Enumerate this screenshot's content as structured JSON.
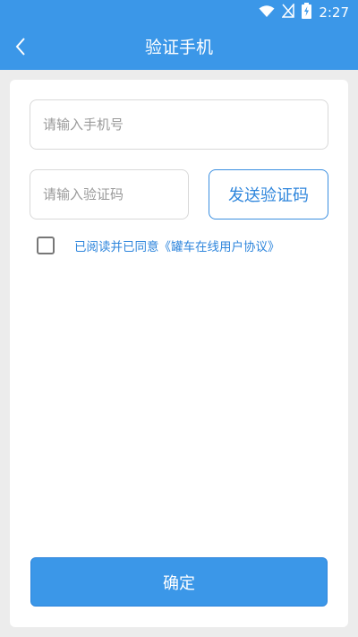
{
  "status_bar": {
    "time": "2:27",
    "icons": [
      "wifi-icon",
      "no-signal-icon",
      "battery-charging-icon"
    ]
  },
  "app_bar": {
    "title": "验证手机",
    "back_icon": "chevron-left-icon"
  },
  "form": {
    "phone_placeholder": "请输入手机号",
    "code_placeholder": "请输入验证码",
    "send_code_label": "发送验证码",
    "agreement_text": "已阅读并已同意《罐车在线用户协议》",
    "agreement_checked": false,
    "confirm_label": "确定"
  },
  "colors": {
    "primary": "#3b97e8",
    "link": "#2f86dc",
    "background": "#ececec"
  }
}
